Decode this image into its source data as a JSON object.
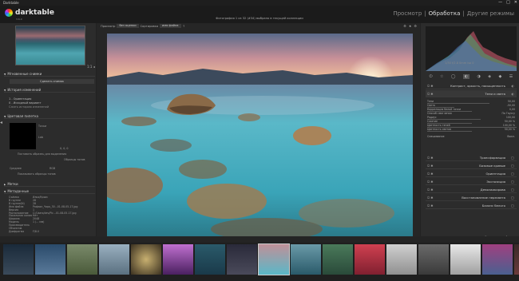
{
  "window": {
    "title": "Darktable",
    "controls": [
      "—",
      "□",
      "✕"
    ]
  },
  "header": {
    "app_name": "darktable",
    "version": "3.6.0",
    "center_text": "Фотография 1 из 32 (#34) выбрано в текущей коллекции",
    "views": [
      "Просмотр",
      "Обработка",
      "Другие режимы"
    ],
    "view_sep": "|"
  },
  "left": {
    "zoom": "1:1 ◂",
    "snapshots": {
      "title": "Мгновенные снимки",
      "button": "Сделать снимок"
    },
    "history": {
      "title": "История изменений",
      "items": [
        "1 - Ориентация",
        "0 - Исходный вариант"
      ],
      "compress": "Сжать историю изменений"
    },
    "colorpicker": {
      "title": "Цветовая пипетка",
      "mean": "Точки",
      "mode": "Lab",
      "values": "0, 0, 0",
      "add_btn": "Поставить образец для выделения",
      "restrict": "Образцы тонов",
      "picker_mode": "Среднее",
      "picker_fmt": "RGB",
      "display_samples": "Показывать образцы тонов"
    },
    "tags": {
      "title": "Метки"
    },
    "metadata": {
      "title": "Метаданные",
      "rows": [
        [
          "Съёмка",
          "Илья/Крым"
        ],
        [
          "В группе",
          "28"
        ],
        [
          "В группе(N)",
          "28"
        ],
        [
          "Имя файла",
          "Рафаэл_Чаро_30...01-08-05-17.jpg"
        ],
        [
          "Версия",
          "1"
        ],
        [
          "Расположение",
          "C:/Users/dev/Pic...01-08-05-17.jpg"
        ],
        [
          "Локальная копия",
          "Нет"
        ],
        [
          "Ширина",
          "2048"
        ],
        [
          "Модель",
          "1 (... мм)"
        ],
        [
          "Производитель",
          ""
        ],
        [
          "Объектив",
          ""
        ],
        [
          "Диафрагма",
          "F/8.0"
        ]
      ]
    }
  },
  "center": {
    "topbar": {
      "sort_label": "Просмотр",
      "sort_value": "без оценки",
      "sort2_label": "Сортировка",
      "sort2_value": "имя файла",
      "dir": "↑"
    },
    "top_icons": [
      "⚙",
      "★",
      "⚙"
    ]
  },
  "right": {
    "histogram_info": "1/30 f/2.8 0mm iso 0",
    "module_header": "Контраст, яркость, насыщенность",
    "shadows_title": "Тени и света",
    "params": [
      [
        "Тени",
        "50,00"
      ],
      [
        "Света",
        "-50,00"
      ],
      [
        "Корреляция белой точки",
        "0,00"
      ],
      [
        "Способ смягчения",
        "По Гауссу"
      ],
      [
        "Радиус",
        "100,00"
      ],
      [
        "Сжатие",
        "50,00 %"
      ],
      [
        "Цветность теней",
        "100,00 %"
      ],
      [
        "Цветность светов",
        "50,00 %"
      ],
      [
        "Смешивание",
        "Выкл."
      ]
    ],
    "modules": [
      "Трансформация",
      "Базовые кривые",
      "Ориентация",
      "Экспозиция",
      "Демозаикирова",
      "Восстановление пересвета",
      "Баланс белого"
    ],
    "more_modules": "Список модулей"
  }
}
